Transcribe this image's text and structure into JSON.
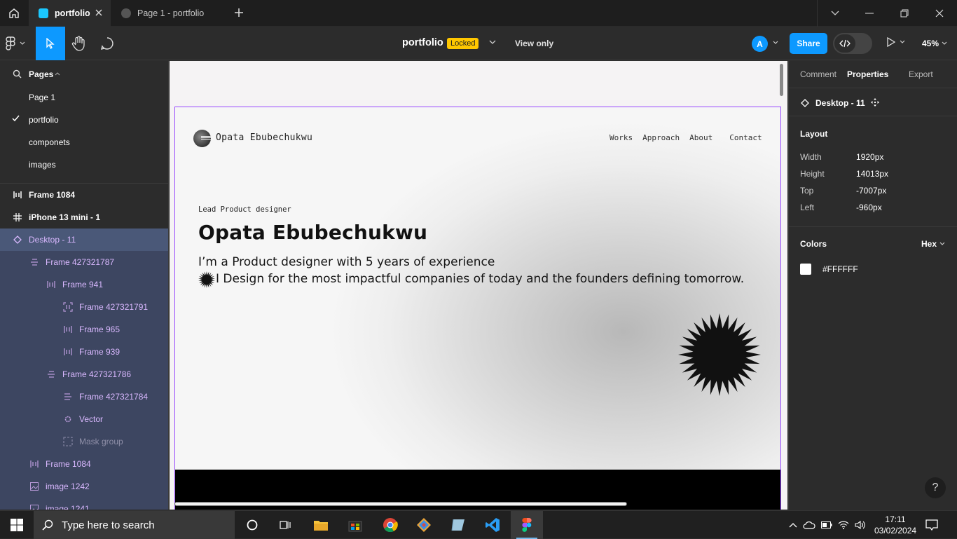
{
  "titlebar": {
    "tabs": [
      {
        "label": "portfolio",
        "active": true
      },
      {
        "label": "Page 1 - portfolio",
        "active": false
      }
    ]
  },
  "toolbar": {
    "file_title": "portfolio",
    "locked_badge": "Locked",
    "view_only": "View only",
    "avatar_initial": "A",
    "share_label": "Share",
    "zoom": "45%"
  },
  "left_panel": {
    "pages_header": "Pages",
    "pages": [
      {
        "label": "Page 1",
        "current": false
      },
      {
        "label": "portfolio",
        "current": true
      },
      {
        "label": "componets",
        "current": false
      },
      {
        "label": "images",
        "current": false
      }
    ],
    "layers": [
      {
        "label": "Frame 1084",
        "icon": "auto-layout-vertical-icon"
      },
      {
        "label": "iPhone 13 mini - 1",
        "icon": "frame-hash-icon"
      },
      {
        "label": "Desktop - 11",
        "icon": "component-diamond-icon"
      },
      {
        "label": "Frame 427321787",
        "icon": "auto-layout-align-icon"
      },
      {
        "label": "Frame 941",
        "icon": "auto-layout-vertical-icon"
      },
      {
        "label": "Frame 427321791",
        "icon": "frame-bracket-icon"
      },
      {
        "label": "Frame 965",
        "icon": "auto-layout-vertical-icon"
      },
      {
        "label": "Frame 939",
        "icon": "auto-layout-vertical-icon"
      },
      {
        "label": "Frame 427321786",
        "icon": "auto-layout-align-icon"
      },
      {
        "label": "Frame 427321784",
        "icon": "auto-layout-align-icon"
      },
      {
        "label": "Vector",
        "icon": "vector-icon"
      },
      {
        "label": "Mask group",
        "icon": "mask-icon"
      },
      {
        "label": "Frame 1084",
        "icon": "auto-layout-vertical-icon"
      },
      {
        "label": "image 1242",
        "icon": "image-icon"
      },
      {
        "label": "image 1241",
        "icon": "image-icon"
      }
    ]
  },
  "canvas": {
    "site": {
      "name": "Opata Ebubechukwu",
      "nav": [
        "Works",
        "Approach",
        "About",
        "Contact"
      ],
      "eyebrow": "Lead Product designer",
      "hero_name": "Opata Ebubechukwu",
      "line1": "I’m a Product designer with 5 years of experience",
      "line2": "I  Design for the most impactful companies of today and the founders defining tomorrow."
    }
  },
  "right_panel": {
    "tabs": [
      "Comment",
      "Properties",
      "Export"
    ],
    "frame_name": "Desktop - 11",
    "layout_title": "Layout",
    "props": [
      {
        "key": "Width",
        "value": "1920px"
      },
      {
        "key": "Height",
        "value": "14013px"
      },
      {
        "key": "Top",
        "value": "-7007px"
      },
      {
        "key": "Left",
        "value": "-960px"
      }
    ],
    "colors_title": "Colors",
    "color_format": "Hex",
    "swatch_hex": "#FFFFFF",
    "help": "?"
  },
  "taskbar": {
    "search_placeholder": "Type here to search",
    "time": "17:11",
    "date": "03/02/2024"
  },
  "colors": {
    "accent": "#0d99ff",
    "locked": "#ffc700",
    "frame_outline": "#9747ff",
    "layer_selected": "#4a5878"
  }
}
